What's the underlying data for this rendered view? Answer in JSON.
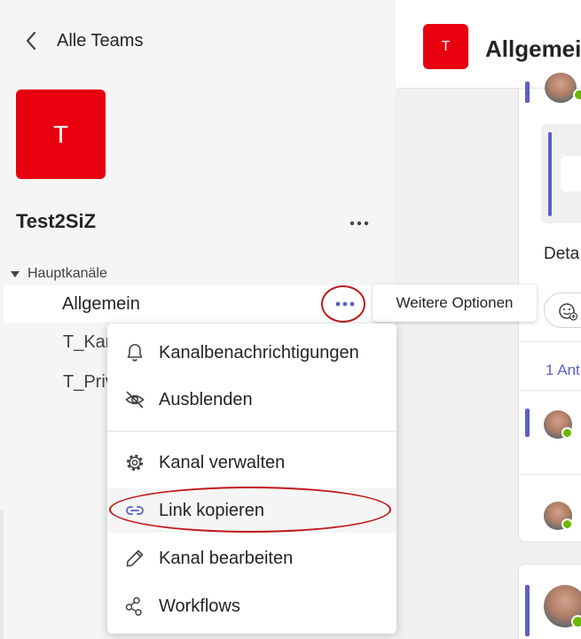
{
  "nav": {
    "back_label": "Alle Teams"
  },
  "team": {
    "avatar_letter": "T",
    "name": "Test2SiZ",
    "avatar_color": "#e8000f"
  },
  "channels": {
    "section_label": "Hauptkanäle",
    "items": [
      {
        "label": "Allgemein"
      },
      {
        "label": "T_Kar"
      },
      {
        "label": "T_Priv"
      }
    ]
  },
  "tooltip": {
    "text": "Weitere Optionen"
  },
  "menu": {
    "items": [
      {
        "label": "Kanalbenachrichtigungen",
        "icon": "bell-icon"
      },
      {
        "label": "Ausblenden",
        "icon": "eye-off-icon"
      },
      {
        "label": "Kanal verwalten",
        "icon": "gear-icon"
      },
      {
        "label": "Link kopieren",
        "icon": "link-icon"
      },
      {
        "label": "Kanal bearbeiten",
        "icon": "pencil-icon"
      },
      {
        "label": "Workflows",
        "icon": "workflow-icon"
      }
    ]
  },
  "channel_header": {
    "avatar_letter": "T",
    "title": "Allgemein"
  },
  "conversation": {
    "preview_text": "Deta",
    "reply_count_text": "1 Ant"
  },
  "colors": {
    "accent": "#5b5fc7",
    "annotation_red": "#c0181c",
    "presence_green": "#6bb700"
  }
}
